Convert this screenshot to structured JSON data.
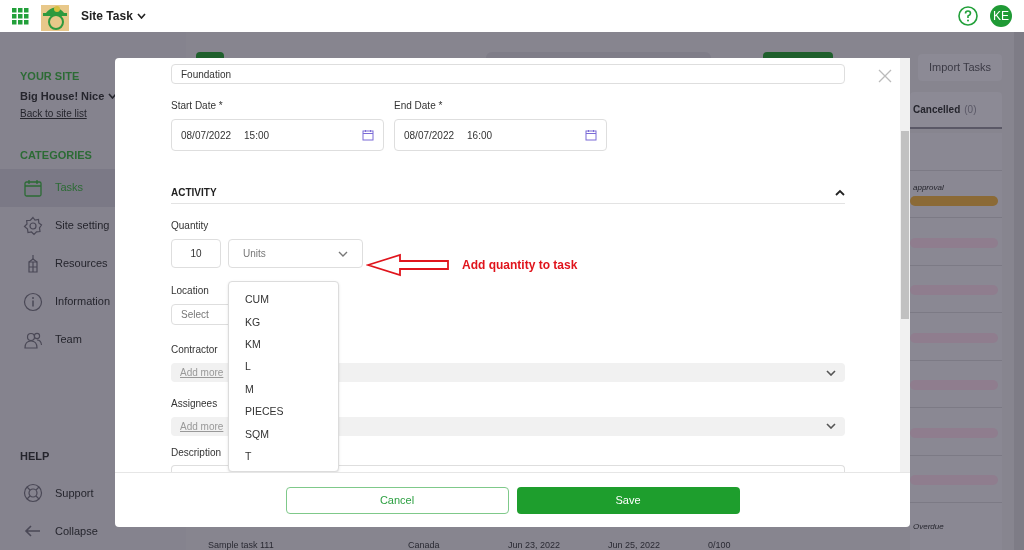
{
  "app_bar": {
    "title": "Site Task",
    "avatar": "KE"
  },
  "sidebar": {
    "site_heading": "YOUR SITE",
    "site_name": "Big House! Nice",
    "back_link": "Back to site list",
    "categories_heading": "CATEGORIES",
    "items": [
      {
        "label": "Tasks",
        "selected": true
      },
      {
        "label": "Site setting",
        "selected": false
      },
      {
        "label": "Resources",
        "selected": false
      },
      {
        "label": "Information",
        "selected": false
      },
      {
        "label": "Team",
        "selected": false
      }
    ],
    "help_heading": "HELP",
    "help_items": [
      {
        "label": "Support"
      },
      {
        "label": "Collapse"
      }
    ]
  },
  "background": {
    "import_button": "Import Tasks",
    "tab": {
      "label": "Cancelled",
      "count": "(0)"
    },
    "rows": [
      {
        "status": "approval",
        "color": "#8b6a36"
      },
      {
        "color": "#8f7d8e"
      },
      {
        "color": "#8f7d8e"
      },
      {
        "color": "#8f7d8e"
      },
      {
        "color": "#8f7d8e"
      },
      {
        "color": "#8f7d8e"
      },
      {
        "color": "#8f7d8e"
      },
      {
        "status": "Overdue"
      }
    ],
    "last_row": [
      "Sample task 111",
      "Canada",
      "Jun 23, 2022",
      "Jun 25, 2022",
      "0/100"
    ]
  },
  "modal": {
    "task_name": "Foundation",
    "start_date": {
      "label": "Start Date *",
      "date": "08/07/2022",
      "time": "15:00"
    },
    "end_date": {
      "label": "End Date *",
      "date": "08/07/2022",
      "time": "16:00"
    },
    "section": {
      "title": "ACTIVITY",
      "expanded": true
    },
    "quantity": {
      "label": "Quantity",
      "value": "10",
      "unit_placeholder": "Units"
    },
    "unit_options": [
      "CUM",
      "KG",
      "KM",
      "L",
      "M",
      "PIECES",
      "SQM",
      "T"
    ],
    "location": {
      "label": "Location",
      "placeholder": "Select"
    },
    "contractor": {
      "label": "Contractor",
      "link": "Add more"
    },
    "assignees": {
      "label": "Assignees",
      "link": "Add more"
    },
    "description": {
      "label": "Description"
    },
    "buttons": {
      "cancel": "Cancel",
      "save": "Save"
    }
  },
  "annotation": {
    "text": "Add quantity to task"
  }
}
